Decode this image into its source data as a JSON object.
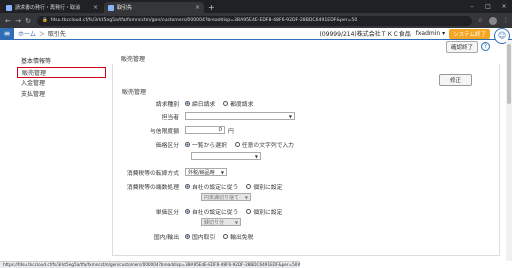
{
  "browser": {
    "tabs": [
      {
        "label": "請求書の発行・再発行・取消",
        "active": false
      },
      {
        "label": "取引先",
        "active": true
      }
    ],
    "url": "fdsu.tkccloud.cf/fs/3rkt5eg5a/tfa/fxmncstm/gen/customers/000004?breaddisp=3BA95E4E-EDF8-48F6-92DF-28BDC6491EDF&per=50",
    "status_url": "https://fdsu.tkccloud.cf/fs/3rkt5eg5a/tfa/fxmncstm/gen/customers/000004?breaddisp=3BA95E4E-EDF8-48F6-92DF-28BDC6491EDF&per=50#salescustomerbasics_title"
  },
  "header": {
    "breadcrumb_home": "ホーム",
    "breadcrumb_current": "取引先",
    "company": "(09999/214)株式会社ＴＫＣ食品",
    "user": "fxadmin",
    "system_exit": "システム終了",
    "confirm_exit": "確認終了",
    "help": "?"
  },
  "section_title_top": "販売管理",
  "sidebar": {
    "items": [
      {
        "label": "基本情報等",
        "selected": false
      },
      {
        "label": "販売管理",
        "selected": true
      },
      {
        "label": "入金管理",
        "selected": false
      },
      {
        "label": "支払管理",
        "selected": false
      }
    ]
  },
  "panel": {
    "save_label": "修正",
    "section_label": "販売管理",
    "fields": {
      "billing_type": {
        "label": "請求種別",
        "options": [
          "締日請求",
          "都度請求"
        ],
        "selected": 0
      },
      "staff": {
        "label": "担当者",
        "value": ""
      },
      "credit_limit": {
        "label": "与信限度額",
        "value": "0",
        "unit": "円"
      },
      "price_class": {
        "label": "価格区分",
        "options": [
          "一覧から選択",
          "任意の文字列で入力"
        ],
        "selected": 0,
        "select_value": ""
      },
      "tax_method": {
        "label": "消費税等の転嫁方式",
        "value": "外税/納品時"
      },
      "tax_rounding": {
        "label": "消費税等の端数処理",
        "options": [
          "自社の設定に従う",
          "個別に設定"
        ],
        "selected": 0,
        "disabled_value": "円未満切り捨て"
      },
      "rounding_class": {
        "label": "単価区分",
        "options": [
          "自社の設定に従う",
          "個別に設定"
        ],
        "selected": 0,
        "disabled_value": "銭切り分"
      },
      "domestic": {
        "label": "国内/輸出",
        "options": [
          "国内取引",
          "輸出免税"
        ],
        "selected": 0
      }
    }
  }
}
